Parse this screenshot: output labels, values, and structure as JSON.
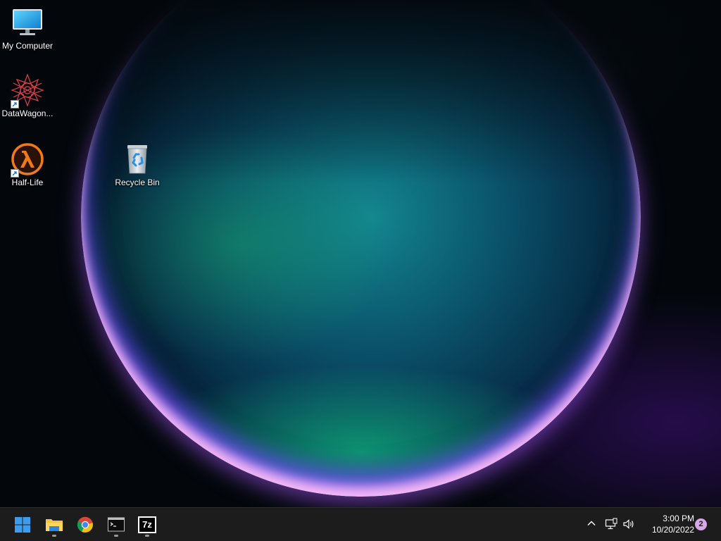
{
  "desktop": {
    "icons": [
      {
        "label": "My Computer",
        "icon": "monitor-icon"
      },
      {
        "label": "DataWagon...",
        "icon": "datawagon-icon",
        "shortcut": true
      },
      {
        "label": "Half-Life",
        "icon": "half-life-icon",
        "shortcut": true
      },
      {
        "label": "Recycle Bin",
        "icon": "recycle-bin-icon"
      }
    ]
  },
  "taskbar": {
    "pinned": [
      {
        "name": "start",
        "icon": "windows-start-icon",
        "running": false
      },
      {
        "name": "file-explorer",
        "icon": "folder-icon",
        "running": true
      },
      {
        "name": "chrome",
        "icon": "chrome-icon",
        "running": false
      },
      {
        "name": "terminal",
        "icon": "command-prompt-icon",
        "running": true
      },
      {
        "name": "7zip",
        "icon": "7zip-icon",
        "label": "7z",
        "running": true
      }
    ],
    "tray": {
      "icons": [
        "chevron-up-icon",
        "network-icon",
        "volume-icon"
      ],
      "time": "3:00 PM",
      "date": "10/20/2022",
      "notification_count": "2"
    }
  },
  "colors": {
    "taskbar_bg": "#1c1c1c",
    "accent_blue": "#3b9cf0",
    "notification_badge": "#d6a8e6"
  }
}
